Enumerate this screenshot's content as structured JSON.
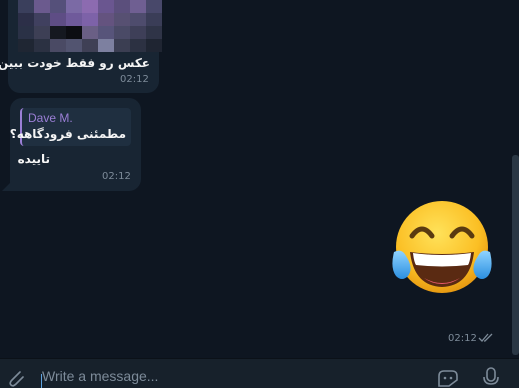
{
  "messages": [
    {
      "text": "عکس رو فقط خودت ببین",
      "time": "02:12"
    },
    {
      "reply_name": "Dave M.",
      "reply_text": "مطمئنی فرودگاهه؟",
      "text": "تاییده",
      "time": "02:12"
    }
  ],
  "sticker": {
    "emoji": "face-with-tears-of-joy",
    "time": "02:12",
    "status": "read"
  },
  "composer": {
    "placeholder": "Write a message..."
  },
  "colors": {
    "background": "#0e1621",
    "bubble": "#182533",
    "reply_accent": "#9b7fd6",
    "bottom_bar": "#17212b"
  }
}
